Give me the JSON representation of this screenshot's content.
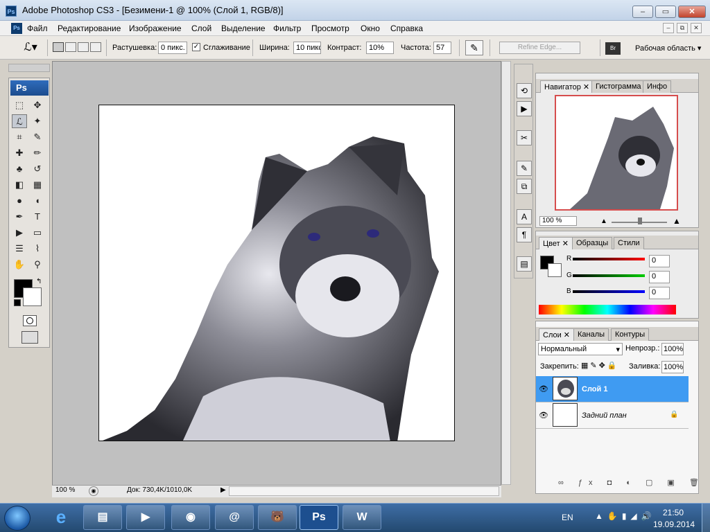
{
  "window": {
    "title": "Adobe Photoshop CS3 - [Безимени-1 @ 100% (Слой 1, RGB/8)]",
    "app_icon": "Ps",
    "controls": {
      "minimize": "–",
      "maximize": "▭",
      "close": "✕"
    }
  },
  "menu": {
    "items": [
      "Файл",
      "Редактирование",
      "Изображение",
      "Слой",
      "Выделение",
      "Фильтр",
      "Просмотр",
      "Окно",
      "Справка"
    ],
    "doc_controls": {
      "minimize": "–",
      "restore": "⧉",
      "close": "✕"
    }
  },
  "options": {
    "feather_label": "Растушевка:",
    "feather_value": "0 пикс.",
    "antialias_label": "Сглаживание",
    "antialias_checked": true,
    "width_label": "Ширина:",
    "width_value": "10 пикс",
    "contrast_label": "Контраст:",
    "contrast_value": "10%",
    "frequency_label": "Частота:",
    "frequency_value": "57",
    "refine_edge": "Refine Edge...",
    "workspace": "Рабочая область ▾"
  },
  "toolbox": {
    "logo": "Ps",
    "tools": [
      {
        "name": "marquee-tool-icon",
        "glyph": "⬚"
      },
      {
        "name": "move-tool-icon",
        "glyph": "✥"
      },
      {
        "name": "magnetic-lasso-tool-icon",
        "glyph": "ℒ",
        "selected": true
      },
      {
        "name": "magic-wand-tool-icon",
        "glyph": "✦"
      },
      {
        "name": "crop-tool-icon",
        "glyph": "⌗"
      },
      {
        "name": "slice-tool-icon",
        "glyph": "✎"
      },
      {
        "name": "healing-brush-tool-icon",
        "glyph": "✚"
      },
      {
        "name": "brush-tool-icon",
        "glyph": "✏"
      },
      {
        "name": "clone-stamp-tool-icon",
        "glyph": "♣"
      },
      {
        "name": "history-brush-tool-icon",
        "glyph": "↺"
      },
      {
        "name": "eraser-tool-icon",
        "glyph": "◧"
      },
      {
        "name": "gradient-tool-icon",
        "glyph": "▦"
      },
      {
        "name": "blur-tool-icon",
        "glyph": "●"
      },
      {
        "name": "dodge-tool-icon",
        "glyph": "◖"
      },
      {
        "name": "pen-tool-icon",
        "glyph": "✒"
      },
      {
        "name": "type-tool-icon",
        "glyph": "T"
      },
      {
        "name": "path-selection-tool-icon",
        "glyph": "▶"
      },
      {
        "name": "shape-tool-icon",
        "glyph": "▭"
      },
      {
        "name": "notes-tool-icon",
        "glyph": "☰"
      },
      {
        "name": "eyedropper-tool-icon",
        "glyph": "⌇"
      },
      {
        "name": "hand-tool-icon",
        "glyph": "✋"
      },
      {
        "name": "zoom-tool-icon",
        "glyph": "⚲"
      }
    ]
  },
  "status": {
    "zoom": "100 %",
    "doc_info": "Док: 730,4K/1010,0K"
  },
  "navigator_panel": {
    "tabs": [
      "Навигатор",
      "Гистограмма",
      "Инфо"
    ],
    "zoom": "100 %"
  },
  "color_panel": {
    "tabs": [
      "Цвет",
      "Образцы",
      "Стили"
    ],
    "r_label": "R",
    "r_value": "0",
    "g_label": "G",
    "g_value": "0",
    "b_label": "B",
    "b_value": "0"
  },
  "layers_panel": {
    "tabs": [
      "Слои",
      "Каналы",
      "Контуры"
    ],
    "blend_mode": "Нормальный",
    "opacity_label": "Непрозр.:",
    "opacity_value": "100%",
    "lock_label": "Закрепить:",
    "fill_label": "Заливка:",
    "fill_value": "100%",
    "layers": [
      {
        "name": "Слой 1",
        "selected": true
      },
      {
        "name": "Задний план",
        "selected": false
      }
    ]
  },
  "taskbar": {
    "lang": "EN",
    "time": "21:50",
    "date": "19.09.2014",
    "apps": [
      "explorer",
      "media",
      "chrome",
      "mail",
      "bear",
      "photoshop",
      "word"
    ],
    "ps_label": "Ps",
    "word_label": "W"
  },
  "colors": {
    "accent_blue": "#3399ff",
    "layer_selected": "#3f9bf2"
  }
}
